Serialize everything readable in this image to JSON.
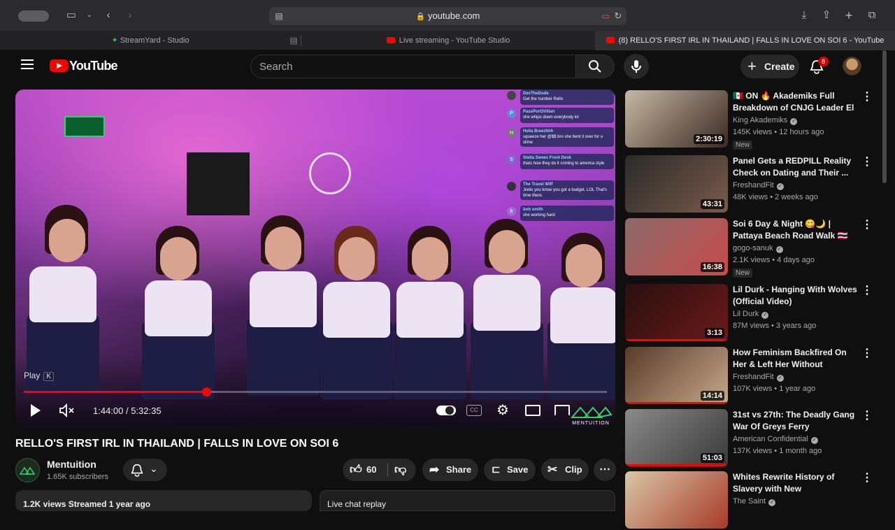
{
  "browser": {
    "url": "youtube.com",
    "tabs": [
      {
        "label": "StreamYard - Studio"
      },
      {
        "label": "Live streaming - YouTube Studio"
      },
      {
        "label": "(8) RELLO'S FIRST IRL IN THAILAND | FALLS IN LOVE ON SOI 6 - YouTube"
      }
    ]
  },
  "header": {
    "logo_text": "YouTube",
    "search_placeholder": "Search",
    "create_label": "Create",
    "notification_count": "8"
  },
  "player": {
    "tooltip": "Play",
    "tooltip_key": "K",
    "time": "1:44:00 / 5:32:35",
    "progress": 0.3125,
    "watermark": "MENTUITION",
    "chat": [
      {
        "name": "DevTheDude",
        "text": "Get the number Rello",
        "initial": ""
      },
      {
        "name": "PassPort3Villan",
        "text": "she whips down everybody lol",
        "initial": "P"
      },
      {
        "name": "Hella Breezhhh",
        "text": "squeeze her @$$ bro she bent it over for u slime",
        "initial": "H"
      },
      {
        "name": "Stella Sweez Front Desk",
        "text": "thats how they do it coming to america style",
        "initial": "S"
      },
      {
        "name": "The Travel Wiff",
        "text": "Jrello you know you got a budget. LOL That's time there.",
        "initial": ""
      },
      {
        "name": "bob smith",
        "text": "she working hard",
        "initial": "b"
      }
    ]
  },
  "video": {
    "title": "RELLO'S FIRST IRL IN THAILAND | FALLS IN LOVE ON SOI 6",
    "channel": "Mentuition",
    "subscribers": "1.65K subscribers",
    "likes": "60",
    "share_label": "Share",
    "save_label": "Save",
    "clip_label": "Clip",
    "views_line": "1.2K views  Streamed 1 year ago",
    "live_chat_replay": "Live chat replay"
  },
  "recommendations": [
    {
      "title": "🇲🇽 ON 🔥 Akademiks Full Breakdown of CNJG Leader El ...",
      "channel": "King Akademiks",
      "meta": "145K views • 12 hours ago",
      "duration": "2:30:19",
      "new": "New",
      "colors": [
        "#c7b8a4",
        "#3a2a24"
      ],
      "watched": 0.0
    },
    {
      "title": "Panel Gets a REDPILL Reality Check on Dating and Their ...",
      "channel": "FreshandFit",
      "meta": "48K views • 2 weeks ago",
      "duration": "43:31",
      "new": "",
      "colors": [
        "#2a2a2a",
        "#7a5a4a"
      ],
      "watched": 0.0
    },
    {
      "title": "Soi 6 Day & Night 😋🌙 | Pattaya Beach Road Walk 🇹🇭",
      "channel": "gogo-sanuk",
      "meta": "2.1K views • 4 days ago",
      "duration": "16:38",
      "new": "New",
      "colors": [
        "#8b6a6a",
        "#c94a4a"
      ],
      "watched": 0.0
    },
    {
      "title": "Lil Durk - Hanging With Wolves (Official Video)",
      "channel": "Lil Durk",
      "meta": "87M views • 3 years ago",
      "duration": "3:13",
      "new": "",
      "colors": [
        "#2a0f0f",
        "#6a1a1a"
      ],
      "watched": 1.0
    },
    {
      "title": "How Feminism Backfired On Her & Left Her Without Options!",
      "channel": "FreshandFit",
      "meta": "107K views • 1 year ago",
      "duration": "14:14",
      "new": "",
      "colors": [
        "#5a3a2a",
        "#c6a88a"
      ],
      "watched": 1.0
    },
    {
      "title": "31st vs 27th: The Deadly Gang War Of Greys Ferry",
      "channel": "American Confidential",
      "meta": "137K views • 1 month ago",
      "duration": "51:03",
      "new": "",
      "colors": [
        "#8a8a8a",
        "#3a3a3a"
      ],
      "watched": 1.0
    },
    {
      "title": "Whites Rewrite History of Slavery with New Documentar...",
      "channel": "The Saint",
      "meta": "",
      "duration": "",
      "new": "",
      "colors": [
        "#d9c7a6",
        "#a63a2a"
      ],
      "watched": 0.0
    }
  ]
}
